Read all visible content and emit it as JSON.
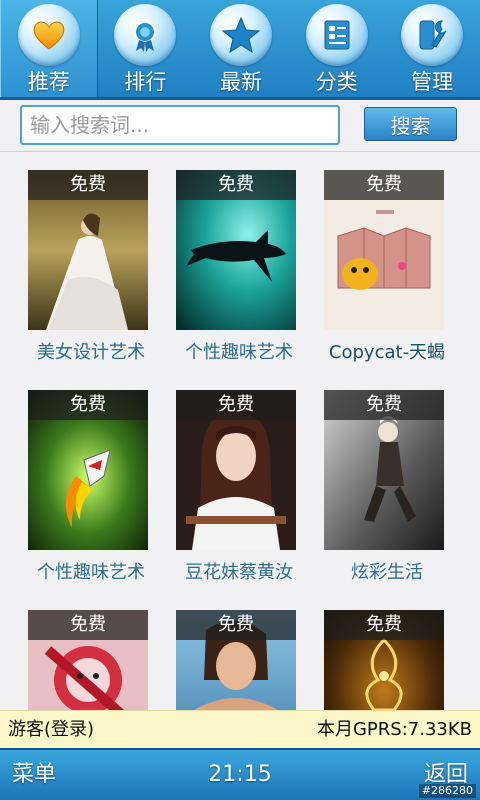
{
  "nav": {
    "tabs": [
      {
        "label": "推荐",
        "icon": "heart-icon",
        "active": true
      },
      {
        "label": "排行",
        "icon": "award-ribbon-icon",
        "active": false
      },
      {
        "label": "最新",
        "icon": "star-icon",
        "active": false
      },
      {
        "label": "分类",
        "icon": "category-list-icon",
        "active": false
      },
      {
        "label": "管理",
        "icon": "wrench-settings-icon",
        "active": false
      }
    ]
  },
  "search": {
    "placeholder": "输入搜索词...",
    "button_label": "搜索"
  },
  "items": [
    {
      "badge": "免费",
      "title": "美女设计艺术",
      "image": "woman-white-dress-photo"
    },
    {
      "badge": "免费",
      "title": "个性趣味艺术",
      "image": "shark-silhouette-photo"
    },
    {
      "badge": "免费",
      "title": "Copycat-天蝎",
      "image": "cartoon-cat-screen-illustration"
    },
    {
      "badge": "免费",
      "title": "个性趣味艺术",
      "image": "rocket-illustration"
    },
    {
      "badge": "免费",
      "title": "豆花妹蔡黄汝",
      "image": "girl-portrait-photo"
    },
    {
      "badge": "免费",
      "title": "炫彩生活",
      "image": "fantasy-woman-photo"
    },
    {
      "badge": "免费",
      "title": "",
      "image": "red-cartoon-illustration"
    },
    {
      "badge": "免费",
      "title": "",
      "image": "tattooed-woman-photo"
    },
    {
      "badge": "免费",
      "title": "",
      "image": "golden-ornament-illustration"
    }
  ],
  "status": {
    "guest": "游客(登录)",
    "gprs": "本月GPRS:7.33KB"
  },
  "bottom": {
    "menu_label": "菜单",
    "time": "21:15",
    "back_label": "返回",
    "watermark": "#286280"
  },
  "colors": {
    "nav_blue": "#2a8fd0",
    "title_text": "#2c6f8a",
    "status_bg": "#fdf7c9"
  }
}
